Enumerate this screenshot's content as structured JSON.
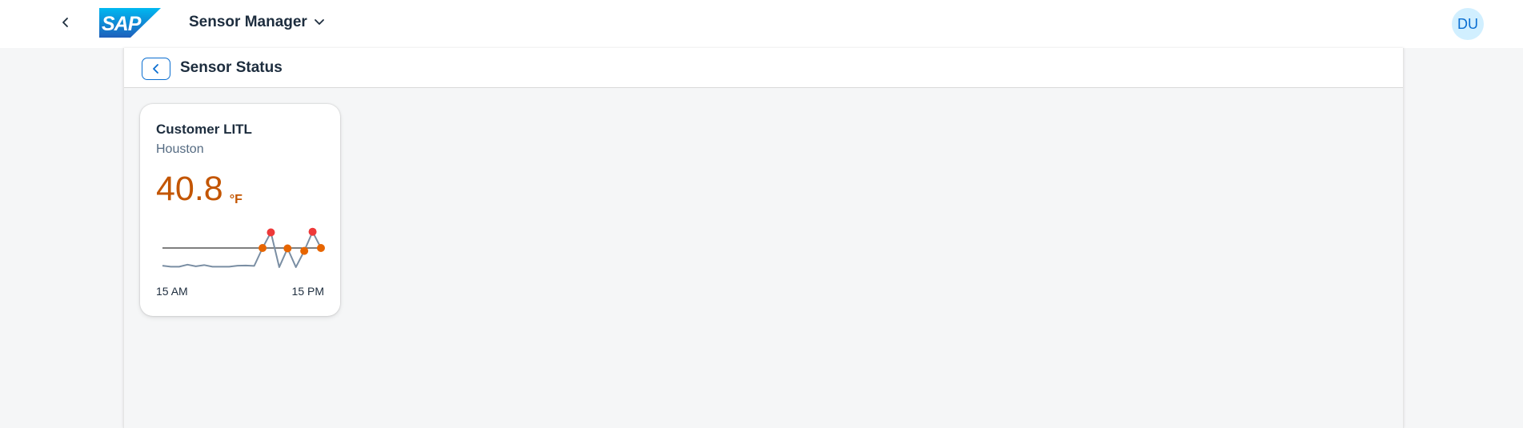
{
  "shell": {
    "app_title": "Sensor Manager",
    "avatar_initials": "DU",
    "logo_text": "SAP"
  },
  "page": {
    "title": "Sensor Status"
  },
  "tile": {
    "title": "Customer LITL",
    "subtitle": "Houston",
    "value": "40.8",
    "unit": "°F",
    "x_start_label": "15 AM",
    "x_end_label": "15 PM"
  },
  "colors": {
    "kpi": "#c35500",
    "line": "#7a8ea3",
    "threshold": "#333333",
    "warning_point": "#e76500",
    "error_point": "#ee3939",
    "accent": "#0a6ed1"
  },
  "chart_data": {
    "type": "line",
    "x_labels": [
      "15 AM",
      "15 PM"
    ],
    "threshold": 40,
    "ylim": [
      30,
      50
    ],
    "series": [
      {
        "values": [
          31.5,
          31.0,
          31.0,
          32.0,
          31.2,
          31.8,
          31.0,
          31.0,
          31.0,
          31.5,
          31.6,
          31.4,
          40.0,
          47.5,
          30.8,
          39.8,
          30.8,
          38.6,
          47.8,
          40.0
        ],
        "point_status": [
          "",
          "",
          "",
          "",
          "",
          "",
          "",
          "",
          "",
          "",
          "",
          "",
          "warning",
          "error",
          "",
          "warning",
          "",
          "warning",
          "error",
          "warning"
        ]
      }
    ]
  }
}
